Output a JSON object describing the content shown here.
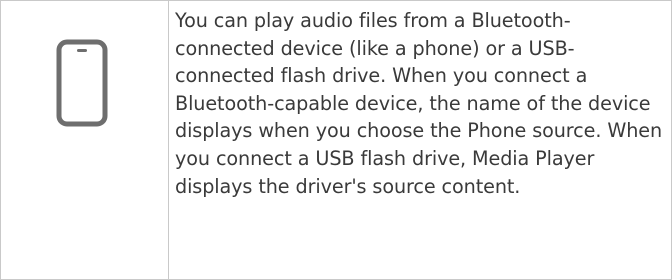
{
  "note": {
    "icon": "phone-icon",
    "icon_color": "#6e6e6e",
    "border_color": "#c9c9c9",
    "text": "You can play audio files from a Bluetooth-connected device (like a phone) or a USB-connected flash drive. When you connect a Bluetooth-capable device, the name of the device displays when you choose the Phone source. When you connect a USB flash drive, Media Player displays the driver's source content."
  }
}
